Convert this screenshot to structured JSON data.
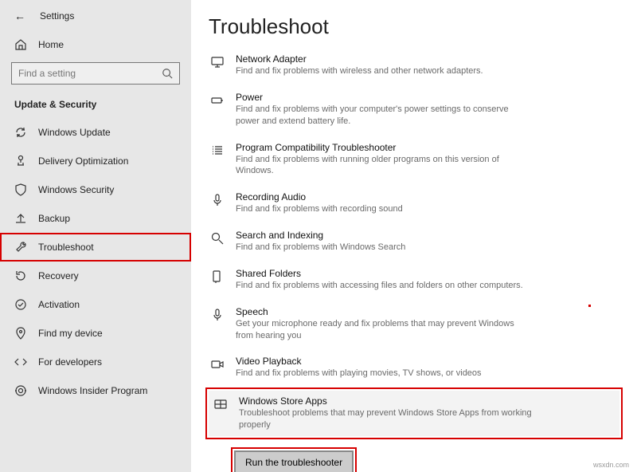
{
  "header": {
    "settings": "Settings"
  },
  "home_label": "Home",
  "search": {
    "placeholder": "Find a setting"
  },
  "section_heading": "Update & Security",
  "nav": [
    {
      "label": "Windows Update"
    },
    {
      "label": "Delivery Optimization"
    },
    {
      "label": "Windows Security"
    },
    {
      "label": "Backup"
    },
    {
      "label": "Troubleshoot"
    },
    {
      "label": "Recovery"
    },
    {
      "label": "Activation"
    },
    {
      "label": "Find my device"
    },
    {
      "label": "For developers"
    },
    {
      "label": "Windows Insider Program"
    }
  ],
  "page_title": "Troubleshoot",
  "items": [
    {
      "title": "Network Adapter",
      "desc": "Find and fix problems with wireless and other network adapters."
    },
    {
      "title": "Power",
      "desc": "Find and fix problems with your computer's power settings to conserve power and extend battery life."
    },
    {
      "title": "Program Compatibility Troubleshooter",
      "desc": "Find and fix problems with running older programs on this version of Windows."
    },
    {
      "title": "Recording Audio",
      "desc": "Find and fix problems with recording sound"
    },
    {
      "title": "Search and Indexing",
      "desc": "Find and fix problems with Windows Search"
    },
    {
      "title": "Shared Folders",
      "desc": "Find and fix problems with accessing files and folders on other computers."
    },
    {
      "title": "Speech",
      "desc": "Get your microphone ready and fix problems that may prevent Windows from hearing you"
    },
    {
      "title": "Video Playback",
      "desc": "Find and fix problems with playing movies, TV shows, or videos"
    },
    {
      "title": "Windows Store Apps",
      "desc": "Troubleshoot problems that may prevent Windows Store Apps from working properly"
    }
  ],
  "run_label": "Run the troubleshooter",
  "watermark": "wsxdn.com"
}
